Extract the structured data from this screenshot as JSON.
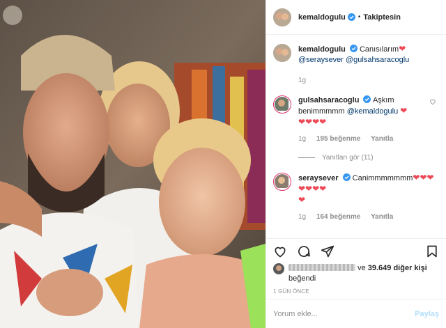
{
  "header": {
    "username": "kemaldogulu",
    "separator": "•",
    "follow_label": "Takiptesin"
  },
  "caption": {
    "username": "kemaldogulu",
    "text": "Canısılarım",
    "mentions": "@seraysever @gulsahsaracoglu",
    "time": "1g"
  },
  "comments": [
    {
      "username": "gulsahsaracoglu",
      "text": "Aşkım benimmmmm",
      "mention": "@kemaldogulu",
      "time": "1g",
      "likes": "195 beğenme",
      "reply_label": "Yanıtla",
      "view_replies": "Yanıtları gör (11)"
    },
    {
      "username": "seraysever",
      "text": "Canimmmmmmm",
      "time": "1g",
      "likes": "164 beğenme",
      "reply_label": "Yanıtla"
    }
  ],
  "likes_summary": {
    "and_text": "ve",
    "count_text": "39.649 diğer kişi",
    "liked_text": "beğendi"
  },
  "time_ago": "1 GÜN ÖNCE",
  "comment_input": {
    "placeholder": "Yorum ekle...",
    "post_label": "Paylaş"
  },
  "icons": [
    "verified-icon",
    "heart-icon",
    "comment-icon",
    "share-icon",
    "save-icon"
  ],
  "colors": {
    "accent_blue": "#3897f0",
    "heart_red": "#ed4956",
    "muted": "#8e8e8e",
    "mention": "#00376b"
  }
}
